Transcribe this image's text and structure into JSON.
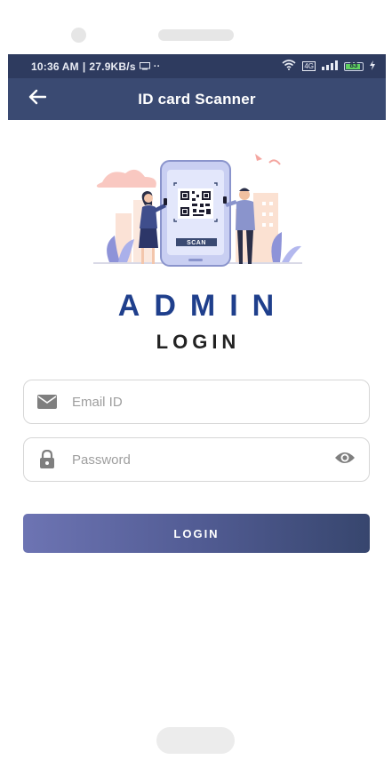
{
  "status_bar": {
    "time": "10:36 AM",
    "separator": "|",
    "net_speed": "27.9KB/s",
    "extra": "··",
    "lte": "4G",
    "battery_level": "83"
  },
  "app_bar": {
    "title": "ID card Scanner",
    "back_icon": "arrow-left-icon"
  },
  "illustration": {
    "scan_label": "SCAN"
  },
  "heading": {
    "admin": "ADMIN",
    "login": "LOGIN"
  },
  "form": {
    "email_placeholder": "Email ID",
    "email_value": "",
    "email_icon": "mail-icon",
    "password_placeholder": "Password",
    "password_value": "",
    "password_icon": "lock-icon",
    "visibility_icon": "eye-icon",
    "login_button": "LOGIN"
  },
  "colors": {
    "status_bar": "#2e3b5f",
    "app_bar": "#3a4a72",
    "admin_text": "#1f3f8c",
    "button_start": "#6d74b3",
    "button_end": "#37466e"
  }
}
